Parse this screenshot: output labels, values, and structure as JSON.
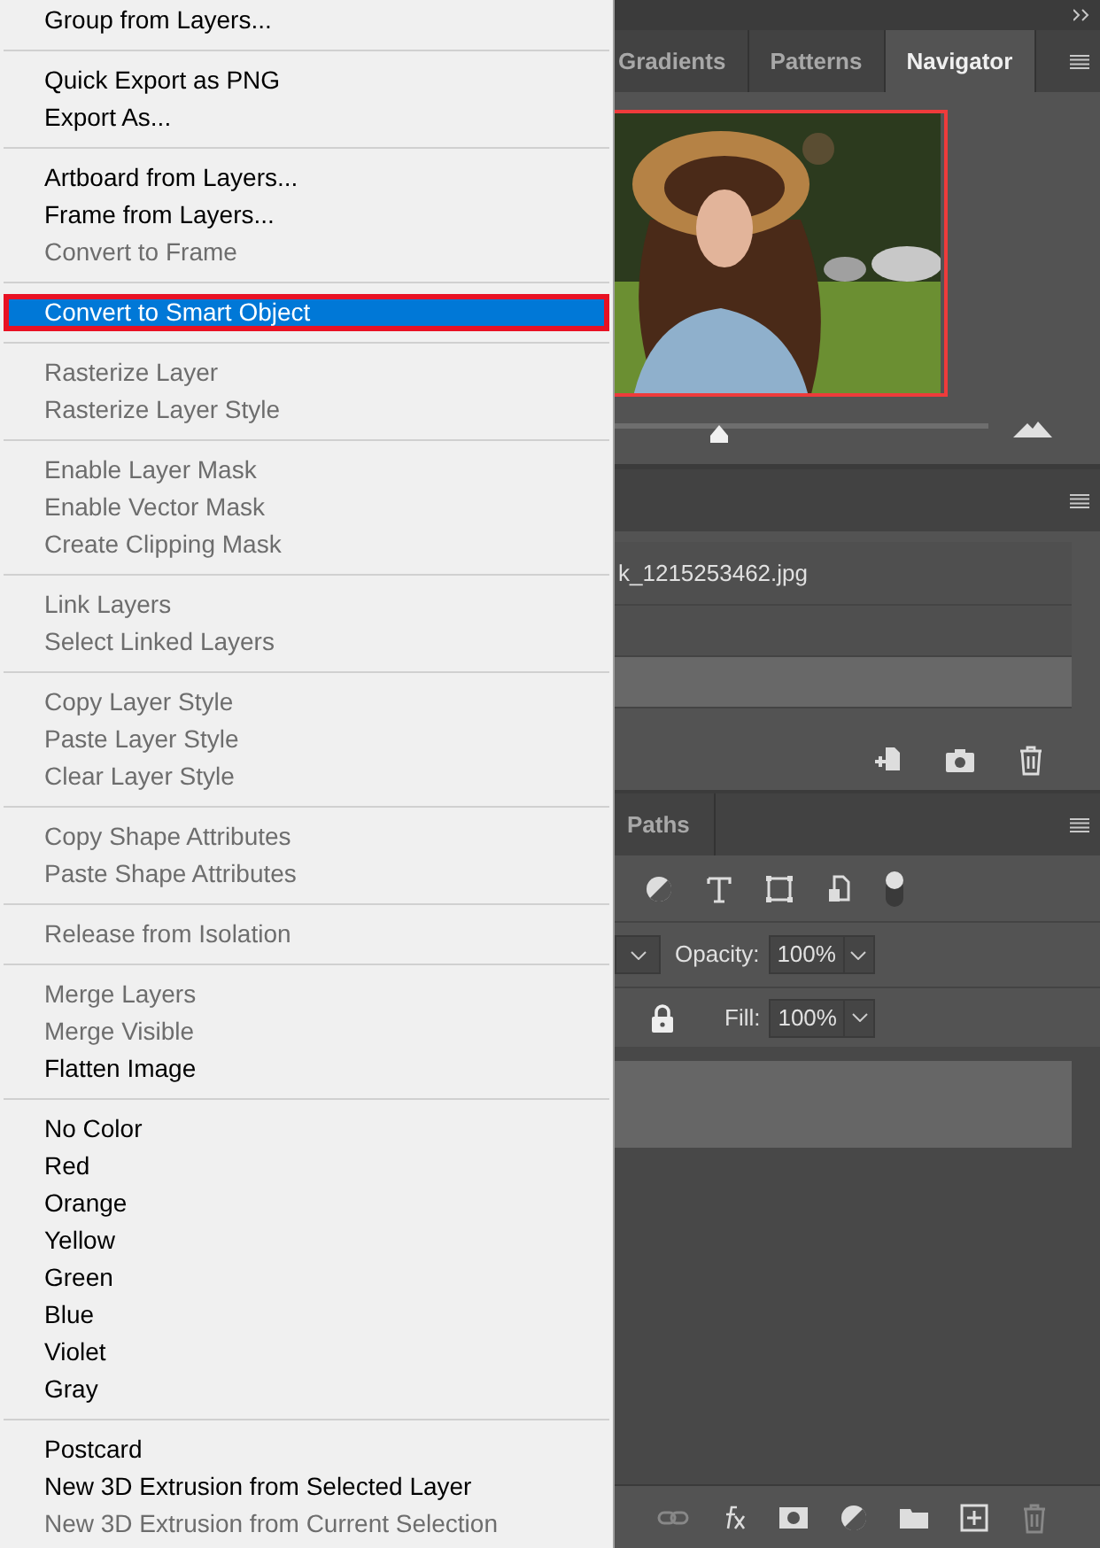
{
  "menu": {
    "sections": [
      [
        {
          "label": "Group from Layers...",
          "disabled": false,
          "selected": false
        }
      ],
      [
        {
          "label": "Quick Export as PNG",
          "disabled": false,
          "selected": false
        },
        {
          "label": "Export As...",
          "disabled": false,
          "selected": false
        }
      ],
      [
        {
          "label": "Artboard from Layers...",
          "disabled": false,
          "selected": false
        },
        {
          "label": "Frame from Layers...",
          "disabled": false,
          "selected": false
        },
        {
          "label": "Convert to Frame",
          "disabled": true,
          "selected": false
        }
      ],
      [
        {
          "label": "Convert to Smart Object",
          "disabled": false,
          "selected": true
        }
      ],
      [
        {
          "label": "Rasterize Layer",
          "disabled": true,
          "selected": false
        },
        {
          "label": "Rasterize Layer Style",
          "disabled": true,
          "selected": false
        }
      ],
      [
        {
          "label": "Enable Layer Mask",
          "disabled": true,
          "selected": false
        },
        {
          "label": "Enable Vector Mask",
          "disabled": true,
          "selected": false
        },
        {
          "label": "Create Clipping Mask",
          "disabled": true,
          "selected": false
        }
      ],
      [
        {
          "label": "Link Layers",
          "disabled": true,
          "selected": false
        },
        {
          "label": "Select Linked Layers",
          "disabled": true,
          "selected": false
        }
      ],
      [
        {
          "label": "Copy Layer Style",
          "disabled": true,
          "selected": false
        },
        {
          "label": "Paste Layer Style",
          "disabled": true,
          "selected": false
        },
        {
          "label": "Clear Layer Style",
          "disabled": true,
          "selected": false
        }
      ],
      [
        {
          "label": "Copy Shape Attributes",
          "disabled": true,
          "selected": false
        },
        {
          "label": "Paste Shape Attributes",
          "disabled": true,
          "selected": false
        }
      ],
      [
        {
          "label": "Release from Isolation",
          "disabled": true,
          "selected": false
        }
      ],
      [
        {
          "label": "Merge Layers",
          "disabled": true,
          "selected": false
        },
        {
          "label": "Merge Visible",
          "disabled": true,
          "selected": false
        },
        {
          "label": "Flatten Image",
          "disabled": false,
          "selected": false
        }
      ],
      [
        {
          "label": "No Color",
          "disabled": false,
          "selected": false
        },
        {
          "label": "Red",
          "disabled": false,
          "selected": false
        },
        {
          "label": "Orange",
          "disabled": false,
          "selected": false
        },
        {
          "label": "Yellow",
          "disabled": false,
          "selected": false
        },
        {
          "label": "Green",
          "disabled": false,
          "selected": false
        },
        {
          "label": "Blue",
          "disabled": false,
          "selected": false
        },
        {
          "label": "Violet",
          "disabled": false,
          "selected": false
        },
        {
          "label": "Gray",
          "disabled": false,
          "selected": false
        }
      ],
      [
        {
          "label": "Postcard",
          "disabled": false,
          "selected": false
        },
        {
          "label": "New 3D Extrusion from Selected Layer",
          "disabled": false,
          "selected": false
        },
        {
          "label": "New 3D Extrusion from Current Selection",
          "disabled": true,
          "selected": false
        }
      ]
    ]
  },
  "navigator": {
    "tabs": [
      {
        "label": "Gradients",
        "selected": false
      },
      {
        "label": "Patterns",
        "selected": false
      },
      {
        "label": "Navigator",
        "selected": true
      }
    ],
    "zoom": {
      "level": 0.28
    }
  },
  "history": {
    "rows": [
      {
        "label": "k_1215253462.jpg",
        "selected": false
      },
      {
        "selected": false
      },
      {
        "selected": true
      }
    ]
  },
  "layers": {
    "tabs": [
      {
        "label": "Paths",
        "selected": false
      }
    ],
    "opacity_label": "Opacity:",
    "opacity": "100%",
    "fill_label": "Fill:",
    "fill": "100%",
    "rows": [
      {
        "selected": true
      }
    ]
  }
}
